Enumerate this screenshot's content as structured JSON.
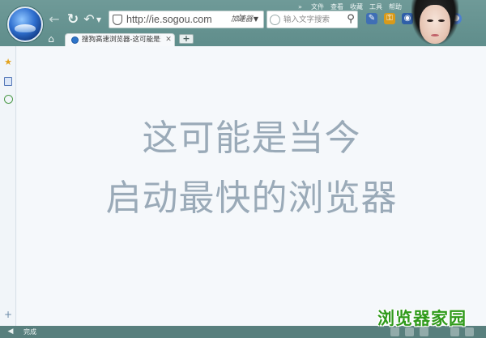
{
  "window": {
    "menu": [
      "文件",
      "查看",
      "收藏",
      "工具",
      "帮助"
    ],
    "menu_more": "»"
  },
  "toolbar": {
    "back_icon": "back-arrow-icon",
    "refresh_icon": "refresh-icon",
    "undo_icon": "undo-icon",
    "address_url": "http://ie.sogou.com",
    "accelerator_label": "加速器",
    "search_placeholder": "输入文字搜索"
  },
  "tabs": [
    {
      "title": "搜狗高速浏览器-这可能是当今启动最快的浏览器",
      "active": true
    }
  ],
  "content": {
    "slogan_line1": "这可能是当今",
    "slogan_line2": "启动最快的浏览器"
  },
  "statusbar": {
    "status_text": "完成"
  },
  "watermark": "浏览器家园",
  "colors": {
    "chrome_bg": "#6f9a98",
    "statusbar_bg": "#587f7d",
    "slogan_text": "#9aaab8",
    "watermark_text": "#2f9a1a"
  }
}
